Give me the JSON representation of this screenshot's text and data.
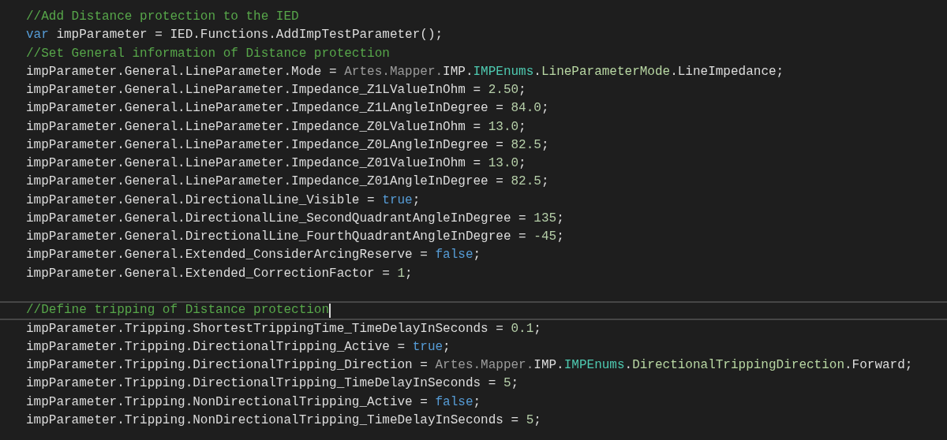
{
  "editor": {
    "lines": [
      {
        "current": false,
        "tokens": [
          {
            "kind": "comment",
            "text": "//Add Distance protection to the IED"
          }
        ]
      },
      {
        "current": false,
        "tokens": [
          {
            "kind": "keyword",
            "text": "var"
          },
          {
            "kind": "plain",
            "text": " impParameter = IED.Functions.AddImpTestParameter();"
          }
        ]
      },
      {
        "current": false,
        "tokens": [
          {
            "kind": "comment",
            "text": "//Set General information of Distance protection"
          }
        ]
      },
      {
        "current": false,
        "tokens": [
          {
            "kind": "plain",
            "text": "impParameter.General.LineParameter.Mode = "
          },
          {
            "kind": "namespace",
            "text": "Artes.Mapper."
          },
          {
            "kind": "plain",
            "text": "IMP."
          },
          {
            "kind": "type",
            "text": "IMPEnums"
          },
          {
            "kind": "plain",
            "text": "."
          },
          {
            "kind": "enumtype",
            "text": "LineParameterMode"
          },
          {
            "kind": "plain",
            "text": ".LineImpedance;"
          }
        ]
      },
      {
        "current": false,
        "tokens": [
          {
            "kind": "plain",
            "text": "impParameter.General.LineParameter.Impedance_Z1LValueInOhm = "
          },
          {
            "kind": "number",
            "text": "2.50"
          },
          {
            "kind": "plain",
            "text": ";"
          }
        ]
      },
      {
        "current": false,
        "tokens": [
          {
            "kind": "plain",
            "text": "impParameter.General.LineParameter.Impedance_Z1LAngleInDegree = "
          },
          {
            "kind": "number",
            "text": "84.0"
          },
          {
            "kind": "plain",
            "text": ";"
          }
        ]
      },
      {
        "current": false,
        "tokens": [
          {
            "kind": "plain",
            "text": "impParameter.General.LineParameter.Impedance_Z0LValueInOhm = "
          },
          {
            "kind": "number",
            "text": "13.0"
          },
          {
            "kind": "plain",
            "text": ";"
          }
        ]
      },
      {
        "current": false,
        "tokens": [
          {
            "kind": "plain",
            "text": "impParameter.General.LineParameter.Impedance_Z0LAngleInDegree = "
          },
          {
            "kind": "number",
            "text": "82.5"
          },
          {
            "kind": "plain",
            "text": ";"
          }
        ]
      },
      {
        "current": false,
        "tokens": [
          {
            "kind": "plain",
            "text": "impParameter.General.LineParameter.Impedance_Z01ValueInOhm = "
          },
          {
            "kind": "number",
            "text": "13.0"
          },
          {
            "kind": "plain",
            "text": ";"
          }
        ]
      },
      {
        "current": false,
        "tokens": [
          {
            "kind": "plain",
            "text": "impParameter.General.LineParameter.Impedance_Z01AngleInDegree = "
          },
          {
            "kind": "number",
            "text": "82.5"
          },
          {
            "kind": "plain",
            "text": ";"
          }
        ]
      },
      {
        "current": false,
        "tokens": [
          {
            "kind": "plain",
            "text": "impParameter.General.DirectionalLine_Visible = "
          },
          {
            "kind": "keyword",
            "text": "true"
          },
          {
            "kind": "plain",
            "text": ";"
          }
        ]
      },
      {
        "current": false,
        "tokens": [
          {
            "kind": "plain",
            "text": "impParameter.General.DirectionalLine_SecondQuadrantAngleInDegree = "
          },
          {
            "kind": "number",
            "text": "135"
          },
          {
            "kind": "plain",
            "text": ";"
          }
        ]
      },
      {
        "current": false,
        "tokens": [
          {
            "kind": "plain",
            "text": "impParameter.General.DirectionalLine_FourthQuadrantAngleInDegree = "
          },
          {
            "kind": "number",
            "text": "-45"
          },
          {
            "kind": "plain",
            "text": ";"
          }
        ]
      },
      {
        "current": false,
        "tokens": [
          {
            "kind": "plain",
            "text": "impParameter.General.Extended_ConsiderArcingReserve = "
          },
          {
            "kind": "keyword",
            "text": "false"
          },
          {
            "kind": "plain",
            "text": ";"
          }
        ]
      },
      {
        "current": false,
        "tokens": [
          {
            "kind": "plain",
            "text": "impParameter.General.Extended_CorrectionFactor = "
          },
          {
            "kind": "number",
            "text": "1"
          },
          {
            "kind": "plain",
            "text": ";"
          }
        ]
      },
      {
        "current": false
      },
      {
        "current": true,
        "tokens": [
          {
            "kind": "comment",
            "text": "//Define tripping of Distance protection"
          }
        ]
      },
      {
        "current": false,
        "tokens": [
          {
            "kind": "plain",
            "text": "impParameter.Tripping.ShortestTrippingTime_TimeDelayInSeconds = "
          },
          {
            "kind": "number",
            "text": "0.1"
          },
          {
            "kind": "plain",
            "text": ";"
          }
        ]
      },
      {
        "current": false,
        "tokens": [
          {
            "kind": "plain",
            "text": "impParameter.Tripping.DirectionalTripping_Active = "
          },
          {
            "kind": "keyword",
            "text": "true"
          },
          {
            "kind": "plain",
            "text": ";"
          }
        ]
      },
      {
        "current": false,
        "tokens": [
          {
            "kind": "plain",
            "text": "impParameter.Tripping.DirectionalTripping_Direction = "
          },
          {
            "kind": "namespace",
            "text": "Artes.Mapper."
          },
          {
            "kind": "plain",
            "text": "IMP."
          },
          {
            "kind": "type",
            "text": "IMPEnums"
          },
          {
            "kind": "plain",
            "text": "."
          },
          {
            "kind": "enumtype",
            "text": "DirectionalTrippingDirection"
          },
          {
            "kind": "plain",
            "text": ".Forward;"
          }
        ]
      },
      {
        "current": false,
        "tokens": [
          {
            "kind": "plain",
            "text": "impParameter.Tripping.DirectionalTripping_TimeDelayInSeconds = "
          },
          {
            "kind": "number",
            "text": "5"
          },
          {
            "kind": "plain",
            "text": ";"
          }
        ]
      },
      {
        "current": false,
        "tokens": [
          {
            "kind": "plain",
            "text": "impParameter.Tripping.NonDirectionalTripping_Active = "
          },
          {
            "kind": "keyword",
            "text": "false"
          },
          {
            "kind": "plain",
            "text": ";"
          }
        ]
      },
      {
        "current": false,
        "tokens": [
          {
            "kind": "plain",
            "text": "impParameter.Tripping.NonDirectionalTripping_TimeDelayInSeconds = "
          },
          {
            "kind": "number",
            "text": "5"
          },
          {
            "kind": "plain",
            "text": ";"
          }
        ]
      }
    ]
  }
}
